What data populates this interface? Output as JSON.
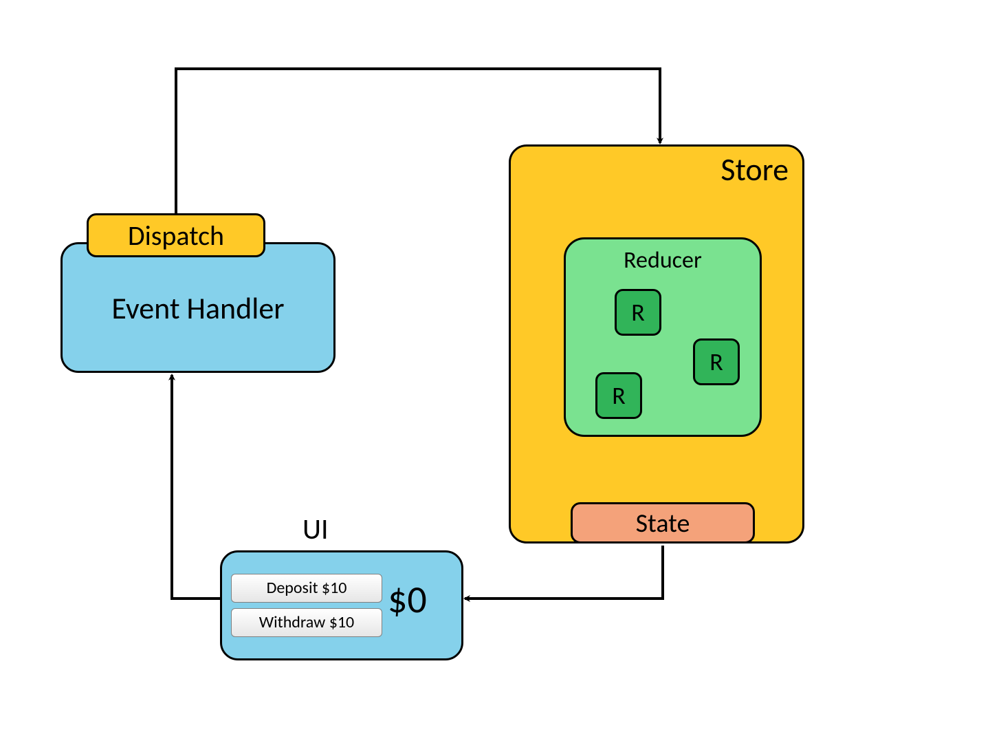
{
  "store": {
    "title": "Store"
  },
  "reducer": {
    "title": "Reducer",
    "r1": "R",
    "r2": "R",
    "r3": "R"
  },
  "state": {
    "label": "State"
  },
  "dispatch": {
    "label": "Dispatch"
  },
  "event_handler": {
    "label": "Event Handler"
  },
  "ui": {
    "title": "UI",
    "deposit_label": "Deposit $10",
    "withdraw_label": "Withdraw $10",
    "balance": "$0"
  }
}
